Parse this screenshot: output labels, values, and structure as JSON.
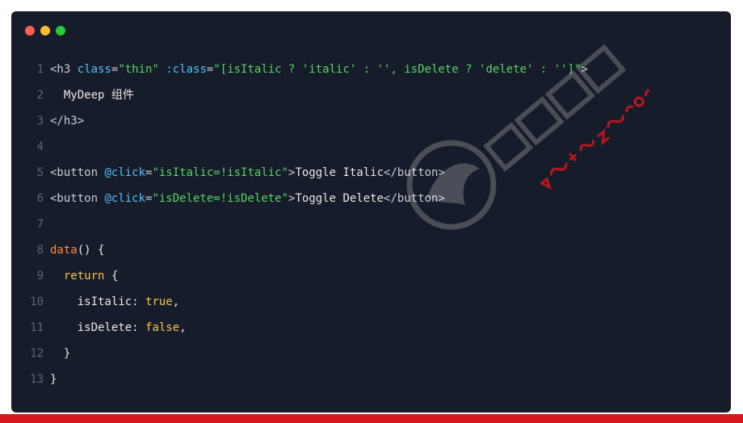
{
  "colors": {
    "dot_red": "#ff5f56",
    "dot_yellow": "#ffbd2e",
    "dot_green": "#27c93f",
    "accent_bar": "#d6171c"
  },
  "code": {
    "lines": [
      {
        "num": "1",
        "parts": [
          "<h3 ",
          "class",
          "=",
          "\"thin\"",
          " ",
          ":class",
          "=",
          "\"[isItalic ? 'italic' : '', isDelete ? 'delete' : '']\"",
          ">"
        ]
      },
      {
        "num": "2",
        "text": "  MyDeep 组件"
      },
      {
        "num": "3",
        "text": "</h3>"
      },
      {
        "num": "4",
        "text": ""
      },
      {
        "num": "5",
        "parts": [
          "<button ",
          "@click",
          "=",
          "\"isItalic=!isItalic\"",
          ">",
          "Toggle Italic",
          "</button>"
        ]
      },
      {
        "num": "6",
        "parts": [
          "<button ",
          "@click",
          "=",
          "\"isDelete=!isDelete\"",
          ">",
          "Toggle Delete",
          "</button>"
        ]
      },
      {
        "num": "7",
        "text": ""
      },
      {
        "num": "8",
        "parts": [
          "data",
          "() {"
        ]
      },
      {
        "num": "9",
        "parts": [
          "  return",
          " {"
        ]
      },
      {
        "num": "10",
        "parts": [
          "    isItalic: ",
          "true",
          ","
        ]
      },
      {
        "num": "11",
        "parts": [
          "    isDelete: ",
          "false",
          ","
        ]
      },
      {
        "num": "12",
        "text": "  }"
      },
      {
        "num": "13",
        "text": "}"
      }
    ]
  },
  "watermark": {
    "brand_cn": "黑马程序员",
    "url": "www.itheima.com"
  }
}
